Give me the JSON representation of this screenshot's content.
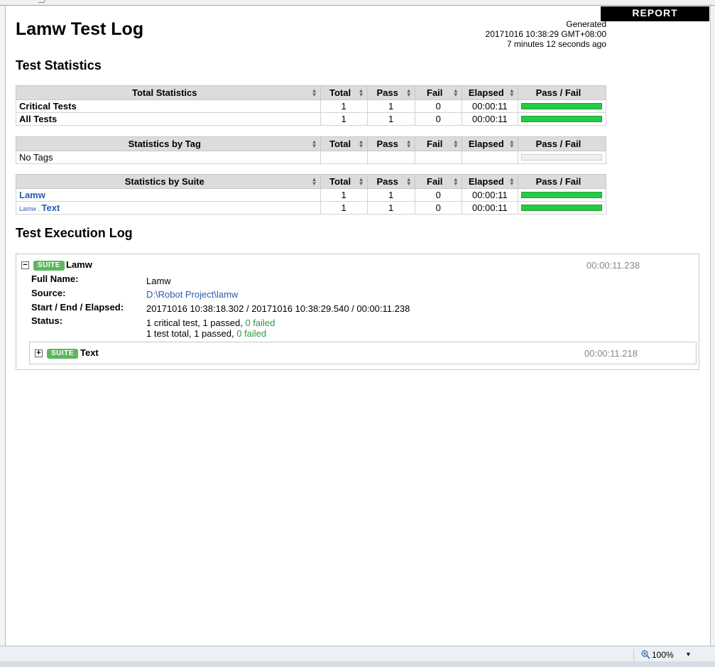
{
  "header": {
    "report_link": "REPORT",
    "title": "Lamw Test Log",
    "generated_label": "Generated",
    "generated_timestamp": "20171016 10:38:29 GMT+08:00",
    "generated_ago": "7 minutes 12 seconds ago"
  },
  "statistics": {
    "heading": "Test Statistics",
    "columns": {
      "total": "Total",
      "pass": "Pass",
      "fail": "Fail",
      "elapsed": "Elapsed",
      "pass_fail": "Pass / Fail"
    },
    "total": {
      "header": "Total Statistics",
      "rows": [
        {
          "name": "Critical Tests",
          "total": "1",
          "pass": "1",
          "fail": "0",
          "elapsed": "00:00:11",
          "pass_ratio": 1.0
        },
        {
          "name": "All Tests",
          "total": "1",
          "pass": "1",
          "fail": "0",
          "elapsed": "00:00:11",
          "pass_ratio": 1.0
        }
      ]
    },
    "tag": {
      "header": "Statistics by Tag",
      "rows": [
        {
          "name": "No Tags",
          "total": "",
          "pass": "",
          "fail": "",
          "elapsed": "",
          "pass_ratio": 0
        }
      ]
    },
    "suite": {
      "header": "Statistics by Suite",
      "rows": [
        {
          "parent": "",
          "name": "Lamw",
          "total": "1",
          "pass": "1",
          "fail": "0",
          "elapsed": "00:00:11",
          "pass_ratio": 1.0
        },
        {
          "parent": "Lamw . ",
          "name": "Text",
          "total": "1",
          "pass": "1",
          "fail": "0",
          "elapsed": "00:00:11",
          "pass_ratio": 1.0
        }
      ]
    }
  },
  "execution_log": {
    "heading": "Test Execution Log",
    "suite": {
      "toggle": "−",
      "badge": "SUITE",
      "name": "Lamw",
      "elapsed": "00:00:11.238",
      "full_name_label": "Full Name:",
      "full_name": "Lamw",
      "source_label": "Source:",
      "source": "D:\\Robot Project\\lamw",
      "times_label": "Start / End / Elapsed:",
      "times": "20171016 10:38:18.302 / 20171016 10:38:29.540 / 00:00:11.238",
      "status_label": "Status:",
      "status_line1_prefix": "1 critical test, 1 passed, ",
      "status_line1_failed": "0 failed",
      "status_line2_prefix": "1 test total, 1 passed, ",
      "status_line2_failed": "0 failed"
    },
    "child_suite": {
      "toggle": "+",
      "badge": "SUITE",
      "name": "Text",
      "elapsed": "00:00:11.218"
    }
  },
  "status_bar": {
    "zoom": "100%",
    "zoom_icon": "magnifier-icon",
    "dropdown_icon": "triangle-down-icon"
  },
  "colors": {
    "pass_bar": "#22cc44",
    "badge": "#5cb85c",
    "link": "#2a5db0",
    "failed_text": "#2a9a3a"
  }
}
